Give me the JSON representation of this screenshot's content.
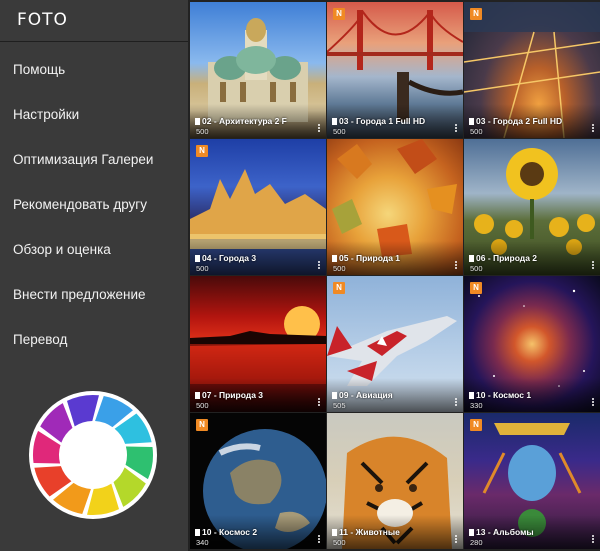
{
  "app": {
    "title": "FOTO"
  },
  "menu": [
    {
      "label": "Помощь"
    },
    {
      "label": "Настройки"
    },
    {
      "label": "Оптимизация Галереи"
    },
    {
      "label": "Рекомендовать другу"
    },
    {
      "label": "Обзор и оценка"
    },
    {
      "label": "Внести предложение"
    },
    {
      "label": "Перевод"
    }
  ],
  "badge_text": "N",
  "tiles": [
    {
      "label": "02 - Архитектура  2 F",
      "count": "500",
      "badge": false
    },
    {
      "label": "03 - Города 1 Full HD",
      "count": "500",
      "badge": true
    },
    {
      "label": "03 - Города 2 Full HD",
      "count": "500",
      "badge": true
    },
    {
      "label": "04 - Города 3",
      "count": "500",
      "badge": true
    },
    {
      "label": "05 - Природа  1",
      "count": "500",
      "badge": false
    },
    {
      "label": "06 - Природа  2",
      "count": "500",
      "badge": false
    },
    {
      "label": "07 - Природа  3",
      "count": "500",
      "badge": false
    },
    {
      "label": "09 - Авиация",
      "count": "505",
      "badge": true
    },
    {
      "label": "10 - Космос 1",
      "count": "330",
      "badge": true
    },
    {
      "label": "10 - Космос 2",
      "count": "340",
      "badge": true
    },
    {
      "label": "11 - Животные",
      "count": "500",
      "badge": false
    },
    {
      "label": "13 - Альбомы",
      "count": "280",
      "badge": true
    }
  ],
  "colors": {
    "sidebar": "#3a3a3a",
    "badge": "#f08a24"
  }
}
